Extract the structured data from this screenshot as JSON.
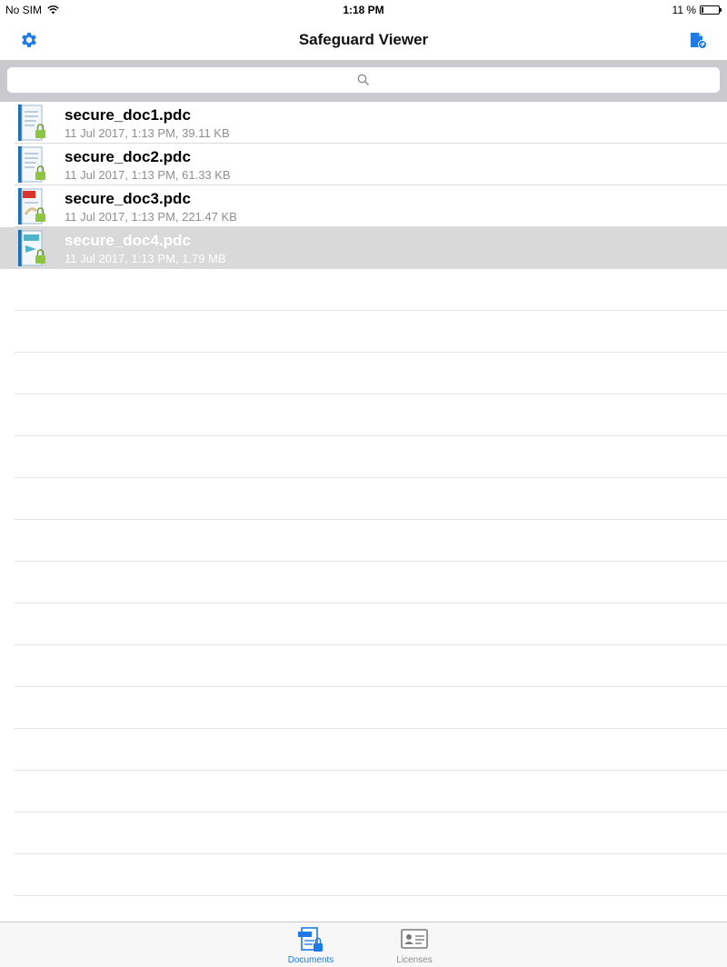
{
  "status_bar": {
    "carrier": "No SIM",
    "time": "1:18 PM",
    "battery_text": "11 %",
    "battery_level": 0.11
  },
  "nav": {
    "title": "Safeguard Viewer",
    "left_icon": "gear-icon",
    "right_icon": "add-document-icon"
  },
  "search": {
    "placeholder": ""
  },
  "documents": [
    {
      "name": "secure_doc1.pdc",
      "meta": "11 Jul 2017, 1:13 PM, 39.11 KB",
      "icon": "locked-doc-icon",
      "selected": false
    },
    {
      "name": "secure_doc2.pdc",
      "meta": "11 Jul 2017, 1:13 PM, 61.33 KB",
      "icon": "locked-doc-icon",
      "selected": false
    },
    {
      "name": "secure_doc3.pdc",
      "meta": "11 Jul 2017, 1:13 PM, 221.47 KB",
      "icon": "locked-pdf-icon",
      "selected": false
    },
    {
      "name": "secure_doc4.pdc",
      "meta": "11 Jul 2017, 1:13 PM, 1.79 MB",
      "icon": "locked-doc-icon",
      "selected": true
    }
  ],
  "tabs": [
    {
      "label": "Documents",
      "active": true
    },
    {
      "label": "Licenses",
      "active": false
    }
  ],
  "colors": {
    "accent": "#1e7ae6",
    "search_bg": "#c9c9ce",
    "selected_row": "#d9d9d9",
    "meta_text": "#8e8e93"
  }
}
